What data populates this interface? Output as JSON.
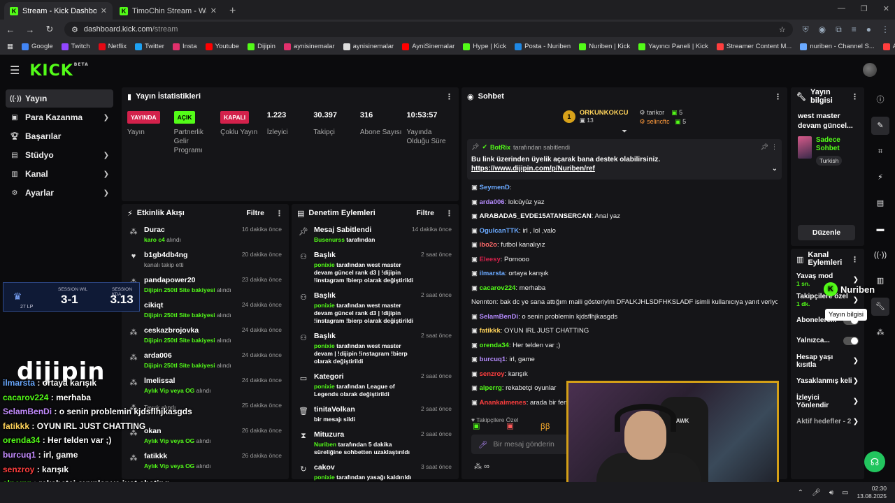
{
  "browser": {
    "tabs": [
      {
        "label": "Stream - Kick Dashboard",
        "active": true
      },
      {
        "label": "TimoChin Stream - Watch Live o...",
        "active": false
      }
    ],
    "url_host": "dashboard.kick.com",
    "url_path": "/stream",
    "bookmarks": [
      "Google",
      "Twitch",
      "Netflix",
      "Twitter",
      "Insta",
      "Youtube",
      "Dijipin",
      "aynisinemalar",
      "aynisinemalar",
      "AyniSinemalar",
      "Hype | Kick",
      "Posta - Nuriben",
      "Nuriben | Kick",
      "Yayıncı Paneli | Kick",
      "Streamer Content M...",
      "nuriben - Channel S...",
      "Aynı Sinemalar - Ça..."
    ]
  },
  "nav": {
    "items": [
      {
        "label": "Yayın",
        "icon": "broadcast-icon"
      },
      {
        "label": "Para Kazanma",
        "icon": "money-icon"
      },
      {
        "label": "Başarılar",
        "icon": "trophy-icon"
      },
      {
        "label": "Stüdyo",
        "icon": "studio-icon"
      },
      {
        "label": "Kanal",
        "icon": "channel-icon"
      },
      {
        "label": "Ayarlar",
        "icon": "gear-icon"
      }
    ]
  },
  "stats_panel": {
    "title": "Yayın İstatistikleri",
    "stats": [
      {
        "badge": "YAYINDA",
        "label": "Yayın"
      },
      {
        "badge": "AÇIK",
        "label": "Partnerlik Gelir Programı"
      },
      {
        "badge": "KAPALI",
        "label": "Çoklu Yayın"
      },
      {
        "value": "1.223",
        "label": "İzleyici"
      },
      {
        "value": "30.397",
        "label": "Takipçi"
      },
      {
        "value": "316",
        "label": "Abone Sayısı"
      },
      {
        "value": "10:53:57",
        "label": "Yayında Olduğu Süre"
      }
    ]
  },
  "activity_feed": {
    "title": "Etkinlik Akışı",
    "filter": "Filtre",
    "items": [
      {
        "name": "Durac",
        "sub_hl": "karo c4",
        "sub": " alındı",
        "time": "16 dakika önce",
        "icon": "gift-icon"
      },
      {
        "name": "b1gb4db4ng",
        "sub_hl": "",
        "sub": "kanalı takip etti",
        "time": "20 dakika önce",
        "icon": "heart-icon"
      },
      {
        "name": "pandapower20",
        "sub_hl": "Dijipin 250tl Site bakiyesi",
        "sub": " alındı",
        "time": "23 dakika önce",
        "icon": "gift-icon"
      },
      {
        "name": "cikiqt",
        "sub_hl": "Dijipin 250tl Site bakiyesi",
        "sub": " alındı",
        "time": "24 dakika önce",
        "icon": "gift-icon"
      },
      {
        "name": "ceskazbrojovka",
        "sub_hl": "Dijipin 250tl Site bakiyesi",
        "sub": " alındı",
        "time": "24 dakika önce",
        "icon": "gift-icon"
      },
      {
        "name": "arda006",
        "sub_hl": "Dijipin 250tl Site bakiyesi",
        "sub": " alındı",
        "time": "24 dakika önce",
        "icon": "gift-icon"
      },
      {
        "name": "lmelissal",
        "sub_hl": "Aylık Vip veya OG",
        "sub": " alındı",
        "time": "24 dakika önce",
        "icon": "gift-icon"
      },
      {
        "name": "",
        "sub_hl": "",
        "sub": "Tavuk alındı",
        "time": "25 dakika önce",
        "icon": "gift-icon"
      },
      {
        "name": "okan",
        "sub_hl": "Aylık Vip veya OG",
        "sub": " alındı",
        "time": "26 dakika önce",
        "icon": "gift-icon"
      },
      {
        "name": "fatikkk",
        "sub_hl": "Aylık Vip veya OG",
        "sub": " alındı",
        "time": "26 dakika önce",
        "icon": "gift-icon"
      }
    ]
  },
  "mod_actions": {
    "title": "Denetim Eylemleri",
    "filter": "Filtre",
    "items": [
      {
        "name": "Mesaj Sabitlendi",
        "actor": "Busenurss",
        "text": " tarafından",
        "time": "14 dakika önce",
        "icon": "pin-icon"
      },
      {
        "name": "Başlık",
        "actor": "ponixie",
        "text": " tarafından west master devam güncel rank d3 | !dijipin !instagram !bierp olarak değiştirildi",
        "time": "2 saat önce",
        "icon": "title-edit-icon"
      },
      {
        "name": "Başlık",
        "actor": "ponixie",
        "text": " tarafından west master devam güncel rank d3 | !dijipin !instagram !bierp olarak değiştirildi",
        "time": "2 saat önce",
        "icon": "title-edit-icon"
      },
      {
        "name": "Başlık",
        "actor": "ponixie",
        "text": " tarafından west master devam | !dijipin !instagram !bierp olarak değiştirildi",
        "time": "2 saat önce",
        "icon": "title-edit-icon"
      },
      {
        "name": "Kategori",
        "actor": "ponixie",
        "text": " tarafından League of Legends olarak değiştirildi",
        "time": "2 saat önce",
        "icon": "category-icon"
      },
      {
        "name": "tinitaVolkan",
        "actor": "",
        "text": "bir mesajı sildi",
        "time": "2 saat önce",
        "icon": "trash-icon"
      },
      {
        "name": "Mituzura",
        "actor": "Nuriben",
        "text": " tarafından 5 dakika süreliğine sohbetten uzaklaştırıldı",
        "time": "2 saat önce",
        "icon": "timer-icon"
      },
      {
        "name": "cakov",
        "actor": "ponixie",
        "text": " tarafından yasağı kaldırıldı",
        "time": "3 saat önce",
        "icon": "unban-icon"
      },
      {
        "name": "cakov",
        "actor": "",
        "text": "",
        "time": "3 saat önce",
        "icon": "ban-icon"
      }
    ]
  },
  "chat": {
    "title": "Sohbet",
    "top_gifter": {
      "rank": "1",
      "name": "ORKUNKOKCU",
      "count": "13"
    },
    "top_list": [
      {
        "name": "tarikor",
        "count": "5"
      },
      {
        "name": "selincftc",
        "count": "5"
      }
    ],
    "pinned": {
      "by": "BotRix",
      "by_text": "tarafından sabitlendi",
      "text": "Bu link üzerinden üyelik açarak bana destek olabilirsiniz.",
      "link": "https://www.dijipin.com/p/Nuriben/ref"
    },
    "messages": [
      {
        "user": "SeymenD",
        "color": "#6aa9ff",
        "text": ""
      },
      {
        "user": "arda006",
        "color": "#b68cff",
        "text": "lolcüyüz yaz"
      },
      {
        "user": "ARABADA5_EVDE15ATANSERCAN",
        "color": "#ffffff",
        "text": "Anal yaz"
      },
      {
        "user": "OgulcanTTK",
        "color": "#6aa9ff",
        "text": "irl , lol ,valo"
      },
      {
        "user": "ibo2o",
        "color": "#ff6a6a",
        "text": "futbol kanalıyız"
      },
      {
        "user": "Eleesy",
        "color": "#d3214b",
        "text": "Pornooo"
      },
      {
        "user": "ilmarsta",
        "color": "#6aa9ff",
        "text": "ortaya karışık"
      },
      {
        "user": "cacarov224",
        "color": "#53fc18",
        "text": "merhaba"
      },
      {
        "user": "SelamBenDi",
        "color": "#b68cff",
        "text": "o senin problemin kjdsflhjkasgds",
        "reply": "Nennton: bak dc ye sana attığım maili gösteriylm DFALKJHLSDFHKSLADF isimli kullanıcıya yanıt veriyor"
      },
      {
        "user": "fatikkk",
        "color": "#ffd35a",
        "text": "OYUN IRL JUST CHATTING"
      },
      {
        "user": "orenda34",
        "color": "#53fc18",
        "text": "Her telden var ;)"
      },
      {
        "user": "burcuq1",
        "color": "#b68cff",
        "text": "irl, game"
      },
      {
        "user": "senzroy",
        "color": "#ff3e3e",
        "text": "karışık"
      },
      {
        "user": "alperrg",
        "color": "#53fc18",
        "text": "rekabetçi oyunlar"
      },
      {
        "user": "Anankaimenes",
        "color": "#ff3e3e",
        "text": "arada bir fener"
      }
    ],
    "followers_label": "Takipçilere Özel",
    "placeholder": "Bir mesaj gönderin"
  },
  "stream_info": {
    "title": "Yayın bilgisi",
    "stream_title": "west master devam güncel...",
    "category": "Sadece Sohbet",
    "tag": "Turkish",
    "edit_button": "Düzenle"
  },
  "channel_actions": {
    "title": "Kanal Eylemleri",
    "items": [
      {
        "label": "Yavaş mod",
        "sub": "1 sn."
      },
      {
        "label": "Takipçilere özel",
        "sub": "1 dk."
      },
      {
        "label": "Abonelere...",
        "sub": ""
      },
      {
        "label": "Yalnızca...",
        "sub": ""
      },
      {
        "label": "Hesap yaşı kısıtla",
        "sub": ""
      },
      {
        "label": "Yasaklanmış keli",
        "sub": ""
      },
      {
        "label": "İzleyici Yönlendir",
        "sub": ""
      },
      {
        "label": "Aktif hedefler - 2",
        "sub": ""
      }
    ]
  },
  "tooltip": "Yayın bilgisi",
  "overlay": {
    "session_label": "SESSION W/L",
    "session_value": "3-1",
    "session_kda_label": "SESSION KDA",
    "session_kda_value": "3.13",
    "lp": "27 LP",
    "brand": "dijipin",
    "watermark": "Nuriben",
    "chat": [
      {
        "user": "ilmarsta",
        "color": "#6aa9ff",
        "text": "ortaya karışık"
      },
      {
        "user": "cacarov224",
        "color": "#53fc18",
        "text": "merhaba"
      },
      {
        "user": "SelamBenDi",
        "color": "#c48cff",
        "text": "o senin problemin kjdsflhjkasgds"
      },
      {
        "user": "fatikkk",
        "color": "#ffd35a",
        "text": "OYUN IRL JUST CHATTING"
      },
      {
        "user": "orenda34",
        "color": "#53fc18",
        "text": "Her telden var ;)"
      },
      {
        "user": "burcuq1",
        "color": "#c48cff",
        "text": "irl, game"
      },
      {
        "user": "senzroy",
        "color": "#ff3e3e",
        "text": "karışık"
      },
      {
        "user": "alperrg",
        "color": "#53fc18",
        "text": "rekabetçi oyunlar ve just chating"
      },
      {
        "user": "Anankaimenes",
        "color": "#ff3e3e",
        "text": "arada bir fener konuşuyoruz"
      }
    ],
    "camera_brand": "HAWK"
  },
  "taskbar": {
    "time": "02:30",
    "date": "13.08.2025"
  },
  "colors": {
    "accent": "#53fc18",
    "live": "#d3214b",
    "panel": "#151518"
  }
}
